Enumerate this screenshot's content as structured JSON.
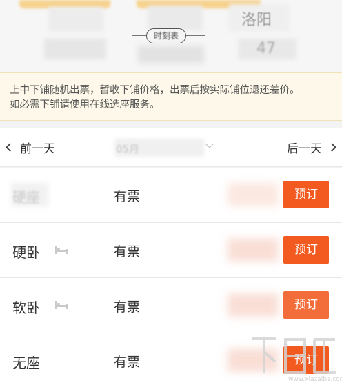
{
  "header": {
    "arrival_station": "洛阳",
    "arrival_time_partial": "47",
    "timetable_label": "时刻表"
  },
  "notice": {
    "text_line1": "上中下铺随机出票，暂收下铺价格，出票后按实际铺位退还差价。",
    "text_line2": "如必需下铺请使用在线选座服务。"
  },
  "date_nav": {
    "prev_label": "前一天",
    "next_label": "后一天",
    "date_partial": "05月"
  },
  "seats": [
    {
      "name": "硬座",
      "status": "有票",
      "book_label": "预订",
      "has_bed_icon": false,
      "blurred_name": true
    },
    {
      "name": "硬卧",
      "status": "有票",
      "book_label": "预订",
      "has_bed_icon": true,
      "blurred_name": false
    },
    {
      "name": "软卧",
      "status": "有票",
      "book_label": "预订",
      "has_bed_icon": true,
      "blurred_name": false
    },
    {
      "name": "无座",
      "status": "有票",
      "book_label": "预订",
      "has_bed_icon": false,
      "blurred_name": false
    }
  ],
  "colors": {
    "accent": "#f25a20",
    "notice_bg": "#fdf8e9",
    "header_bar": "#f7c66a"
  },
  "icons": {
    "bed": "bed-icon",
    "prev": "chevron-left-icon",
    "next": "chevron-right-icon",
    "dropdown": "chevron-down-icon"
  }
}
